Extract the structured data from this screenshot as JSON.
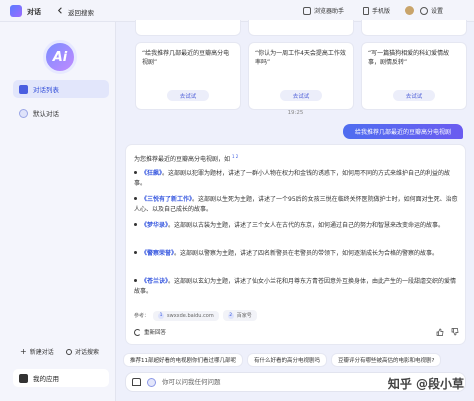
{
  "topbar": {
    "app_name": "对话",
    "back_label": "返回搜索",
    "browser_helper": "浏览器助手",
    "mobile": "手机版",
    "settings": "设置"
  },
  "sidebar": {
    "logo_text": "Ai",
    "items": [
      {
        "label": "对话列表"
      },
      {
        "label": "默认对话"
      }
    ],
    "new_chat": "新建对话",
    "search_chat": "对话搜索",
    "my_apps": "我的应用"
  },
  "suggestions": [
    {
      "text": "“给我推荐几部最近的豆瓣高分电视剧”",
      "button": "去试试"
    },
    {
      "text": "“你认为一周工作4天会提高工作效率吗”",
      "button": "去试试"
    },
    {
      "text": "“写一篇猫狗相爱的科幻爱情故事，剧情反转”",
      "button": "去试试"
    }
  ],
  "timestamp": "19:25",
  "user_message": "给我推荐几部最近的豆瓣高分电视剧",
  "answer": {
    "intro": "为您推荐最近的豆瓣高分电视剧，如",
    "intro_refs": "1  2",
    "items": [
      {
        "title": "《狂飙》",
        "text": "。这部剧以犯罪为题材，讲述了一群小人物在权力和金钱的诱惑下，如何用不同的方式来维护自己的利益的故事。"
      },
      {
        "title": "《三悦有了新工作》",
        "text": "。这部剧以生死为主题，讲述了一个95后的女孩三悦在临终关怀医院做护士时，如何面对生死、治愈人心、以及自己成长的故事。"
      },
      {
        "title": "《梦华录》",
        "text": "。这部剧以古装为主题，讲述了三个女人在古代的东京，如何通过自己的努力和智慧来改变命运的故事。"
      },
      {
        "title": "《警察荣誉》",
        "text": "。这部剧以警察为主题，讲述了四名新警员在老警员的带领下，如何逐渐成长为合格的警察的故事。"
      },
      {
        "title": "《苍兰诀》",
        "text": "。这部剧以玄幻为主题，讲述了仙女小兰花和月尊东方青苍因意外互换身体，由此产生的一段甜虐交织的爱情故事。"
      }
    ],
    "refs_label": "参考：",
    "refs": [
      {
        "num": "1",
        "label": "swxxde.baidu.com"
      },
      {
        "num": "2",
        "label": "百家号"
      }
    ],
    "regenerate": "重新回答"
  },
  "followups": [
    "推荐11部超好看的电视剧你们看过哪几部呢",
    "有什么好看的高分电视剧吗",
    "豆瓣评分有哪些被高估的电影和电视剧?"
  ],
  "input": {
    "placeholder": "你可以问我任何问题"
  },
  "watermark": "知乎 @段小草"
}
